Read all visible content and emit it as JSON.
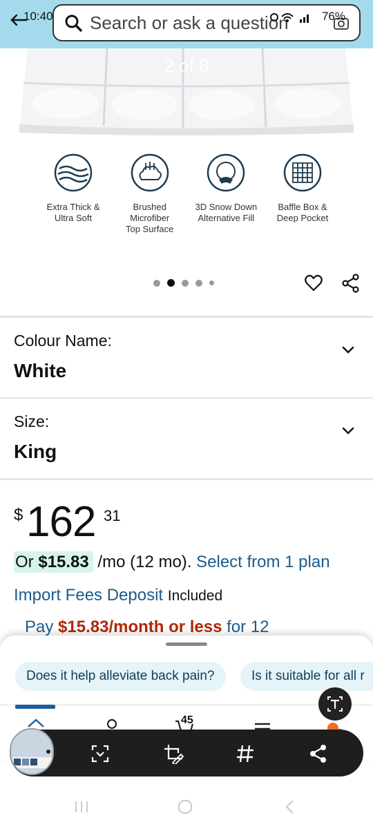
{
  "status": {
    "time": "10:40",
    "battery": "76%"
  },
  "search": {
    "placeholder": "Search or ask a question"
  },
  "product_image": {
    "counter": "2 of 8"
  },
  "features": [
    {
      "icon": "waves-icon",
      "text": "Extra Thick &\nUltra Soft"
    },
    {
      "icon": "cloud-icon",
      "text": "Brushed Microfiber\nTop Surface"
    },
    {
      "icon": "cotton-icon",
      "text": "3D Snow Down\nAlternative Fill"
    },
    {
      "icon": "grid-icon",
      "text": "Baffle Box &\nDeep Pocket"
    }
  ],
  "carousel": {
    "dots": 5,
    "active": 1
  },
  "colour": {
    "label": "Colour Name:",
    "value": "White"
  },
  "size": {
    "label": "Size:",
    "value": "King"
  },
  "price": {
    "currency": "$",
    "whole": "162",
    "fraction": "31"
  },
  "monthly": {
    "or": "Or",
    "amount": "$15.83",
    "term": "/mo (12 mo).",
    "link": "Select from 1 plan"
  },
  "fees": {
    "link": "Import Fees Deposit",
    "status": "Included"
  },
  "pay": {
    "prefix": "Pay",
    "amount": "$15.83/month or less",
    "suffix": "for 12"
  },
  "chips": [
    "Does it help alleviate back pain?",
    "Is it suitable for all r"
  ],
  "bottom_nav": {
    "cart_count": "45"
  },
  "colors": {
    "accent": "#1a5c8c",
    "price_red": "#b12704",
    "topbar": "#a3dbec",
    "chip_bg": "#e5f4f8"
  }
}
